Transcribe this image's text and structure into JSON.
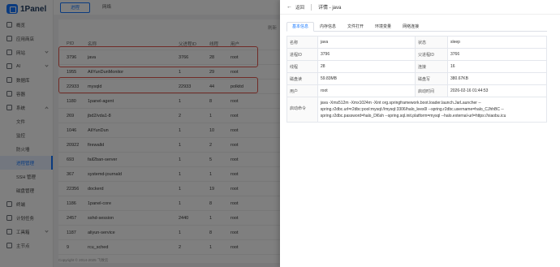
{
  "brand": {
    "name": "1Panel"
  },
  "sidebar": {
    "items": [
      {
        "label": "概览",
        "icon": "dashboard-icon"
      },
      {
        "label": "应用商店",
        "icon": "store-icon"
      },
      {
        "label": "网站",
        "icon": "globe-icon"
      },
      {
        "label": "AI",
        "icon": "ai-icon"
      },
      {
        "label": "数据库",
        "icon": "database-icon"
      },
      {
        "label": "容器",
        "icon": "container-icon"
      },
      {
        "label": "系统",
        "icon": "system-icon"
      }
    ],
    "sub_items": [
      {
        "label": "文件"
      },
      {
        "label": "监控"
      },
      {
        "label": "防火墙"
      },
      {
        "label": "进程管理"
      },
      {
        "label": "SSH 管理"
      },
      {
        "label": "磁盘管理"
      }
    ],
    "bottom_items": [
      {
        "label": "终端",
        "icon": "terminal-icon"
      },
      {
        "label": "计划任务",
        "icon": "cron-icon"
      },
      {
        "label": "工具箱",
        "icon": "toolbox-icon"
      },
      {
        "label": "主节点",
        "icon": "node-icon"
      }
    ]
  },
  "top_tabs": {
    "process": "进程",
    "network": "网络"
  },
  "toolbar": {
    "refresh": "刷新"
  },
  "table": {
    "headers": {
      "pid": "PID",
      "name": "名称",
      "ppid": "父进程ID",
      "threads": "线程",
      "user": "用户"
    },
    "rows": [
      {
        "pid": "3796",
        "name": "java",
        "ppid": "3766",
        "threads": "28",
        "user": "root"
      },
      {
        "pid": "1955",
        "name": "AliYunDunMonitor",
        "ppid": "1",
        "threads": "29",
        "user": "root"
      },
      {
        "pid": "22933",
        "name": "mysqld",
        "ppid": "22933",
        "threads": "44",
        "user": "polkitd"
      },
      {
        "pid": "1180",
        "name": "1panel-agent",
        "ppid": "1",
        "threads": "8",
        "user": "root"
      },
      {
        "pid": "269",
        "name": "jbd2/vda1-8",
        "ppid": "2",
        "threads": "1",
        "user": "root"
      },
      {
        "pid": "1046",
        "name": "AliYunDun",
        "ppid": "1",
        "threads": "10",
        "user": "root"
      },
      {
        "pid": "20922",
        "name": "firewalld",
        "ppid": "1",
        "threads": "2",
        "user": "root"
      },
      {
        "pid": "693",
        "name": "fail2ban-server",
        "ppid": "1",
        "threads": "5",
        "user": "root"
      },
      {
        "pid": "367",
        "name": "systemd-journald",
        "ppid": "1",
        "threads": "1",
        "user": "root"
      },
      {
        "pid": "22356",
        "name": "dockerd",
        "ppid": "1",
        "threads": "19",
        "user": "root"
      },
      {
        "pid": "1186",
        "name": "1panel-core",
        "ppid": "1",
        "threads": "8",
        "user": "root"
      },
      {
        "pid": "2457",
        "name": "sshd-session",
        "ppid": "2440",
        "threads": "1",
        "user": "root"
      },
      {
        "pid": "1187",
        "name": "aliyun-service",
        "ppid": "1",
        "threads": "8",
        "user": "root"
      },
      {
        "pid": "9",
        "name": "rcu_sched",
        "ppid": "2",
        "threads": "1",
        "user": "root"
      }
    ]
  },
  "footer": {
    "copyright": "Copyright © 2014-2025 飞致云"
  },
  "drawer": {
    "back_label": "返回",
    "title": "详情 - java",
    "tabs": [
      "基本信息",
      "内存信息",
      "文件打开",
      "环境变量",
      "网络连接"
    ],
    "info": {
      "name_label": "名称",
      "name": "java",
      "status_label": "状态",
      "status": "sleep",
      "pid_label": "进程ID",
      "pid": "3796",
      "ppid_label": "父进程ID",
      "ppid": "3766",
      "threads_label": "线程",
      "threads": "28",
      "conn_label": "连接",
      "conn": "16",
      "disk_read_label": "磁盘读",
      "disk_read": "59.83MB",
      "disk_write_label": "磁盘写",
      "disk_write": "380.67KB",
      "user_label": "用户",
      "user": "root",
      "start_label": "启动时间",
      "start": "2026-02-16 01:44:53",
      "cmd_label": "启动命令",
      "cmd": "java -Xms512m -Xmx1024m -Xint org.springframework.boot.loader.launch.JarLauncher --spring.r2dbc.url=r2dbc:pool:mysql://mysql:3306/halo_lees0l --spring.r2dbc.username=halo_CJhhBC --spring.r2dbc.password=halo_Dl6sh --spring.sql.init.platform=mysql --halo.external-url=https://xiaobu.icu"
    }
  },
  "colors": {
    "accent": "#1677ff",
    "highlight": "#e3584f"
  }
}
